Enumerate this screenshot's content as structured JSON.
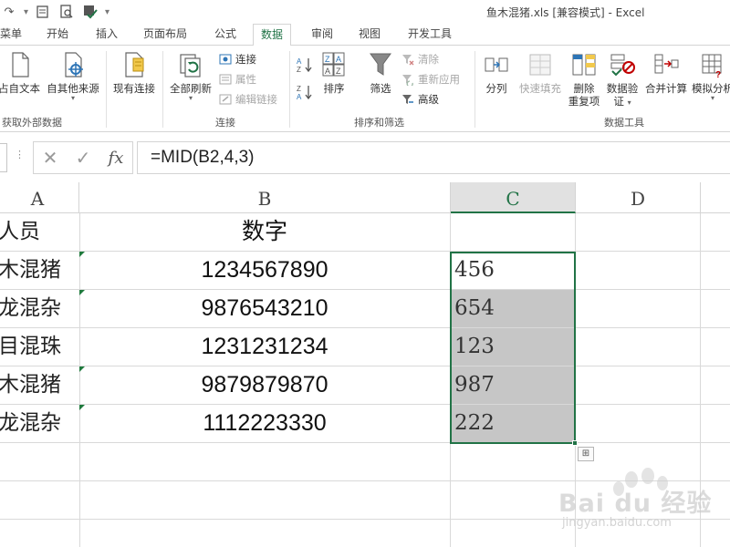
{
  "window": {
    "title": "鱼木混猪.xls  [兼容模式] - Excel"
  },
  "quick_access": {
    "customize_caret": "▾"
  },
  "tabs": [
    {
      "label": "菜单"
    },
    {
      "label": "开始"
    },
    {
      "label": "插入"
    },
    {
      "label": "页面布局"
    },
    {
      "label": "公式"
    },
    {
      "label": "数据",
      "active": true
    },
    {
      "label": "审阅"
    },
    {
      "label": "视图"
    },
    {
      "label": "开发工具"
    }
  ],
  "ribbon": {
    "get_external": {
      "label": "获取外部数据",
      "from_text": "自文本",
      "text_prefix": "占",
      "other_sources": "自其他来源",
      "existing": "现有连接"
    },
    "connections": {
      "label": "连接",
      "refresh_all": "全部刷新",
      "connections": "连接",
      "properties": "属性",
      "edit_links": "编辑链接"
    },
    "sort_filter": {
      "label": "排序和筛选",
      "sort": "排序",
      "filter": "筛选",
      "clear": "清除",
      "reapply": "重新应用",
      "advanced": "高级"
    },
    "data_tools": {
      "label": "数据工具",
      "text_to_columns": "分列",
      "flash_fill": "快速填充",
      "remove_dup_line1": "删除",
      "remove_dup_line2": "重复项",
      "validation_line1": "数据验",
      "validation_line2": "证",
      "consolidate": "合并计算",
      "whatif": "模拟分析"
    }
  },
  "formula_bar": {
    "cancel": "✕",
    "enter": "✓",
    "fx": "fx",
    "formula": "=MID(B2,4,3)"
  },
  "columns": [
    "A",
    "B",
    "C",
    "D"
  ],
  "header_row": {
    "a": "人员",
    "b": "数字"
  },
  "rows": [
    {
      "a": "木混猪",
      "b": "1234567890",
      "c": "456"
    },
    {
      "a": "龙混杂",
      "b": "9876543210",
      "c": "654"
    },
    {
      "a": "目混珠",
      "b": "1231231234",
      "c": "123"
    },
    {
      "a": "木混猪",
      "b": "9879879870",
      "c": "987"
    },
    {
      "a": "龙混杂",
      "b": "1112223330",
      "c": "222"
    }
  ],
  "quick_analysis_icon": "⊞",
  "watermark": {
    "brand": "Bai du 经验",
    "url": "jingyan.baidu.com"
  },
  "colors": {
    "accent": "#217346",
    "selection_shade": "#c6c6c6"
  }
}
